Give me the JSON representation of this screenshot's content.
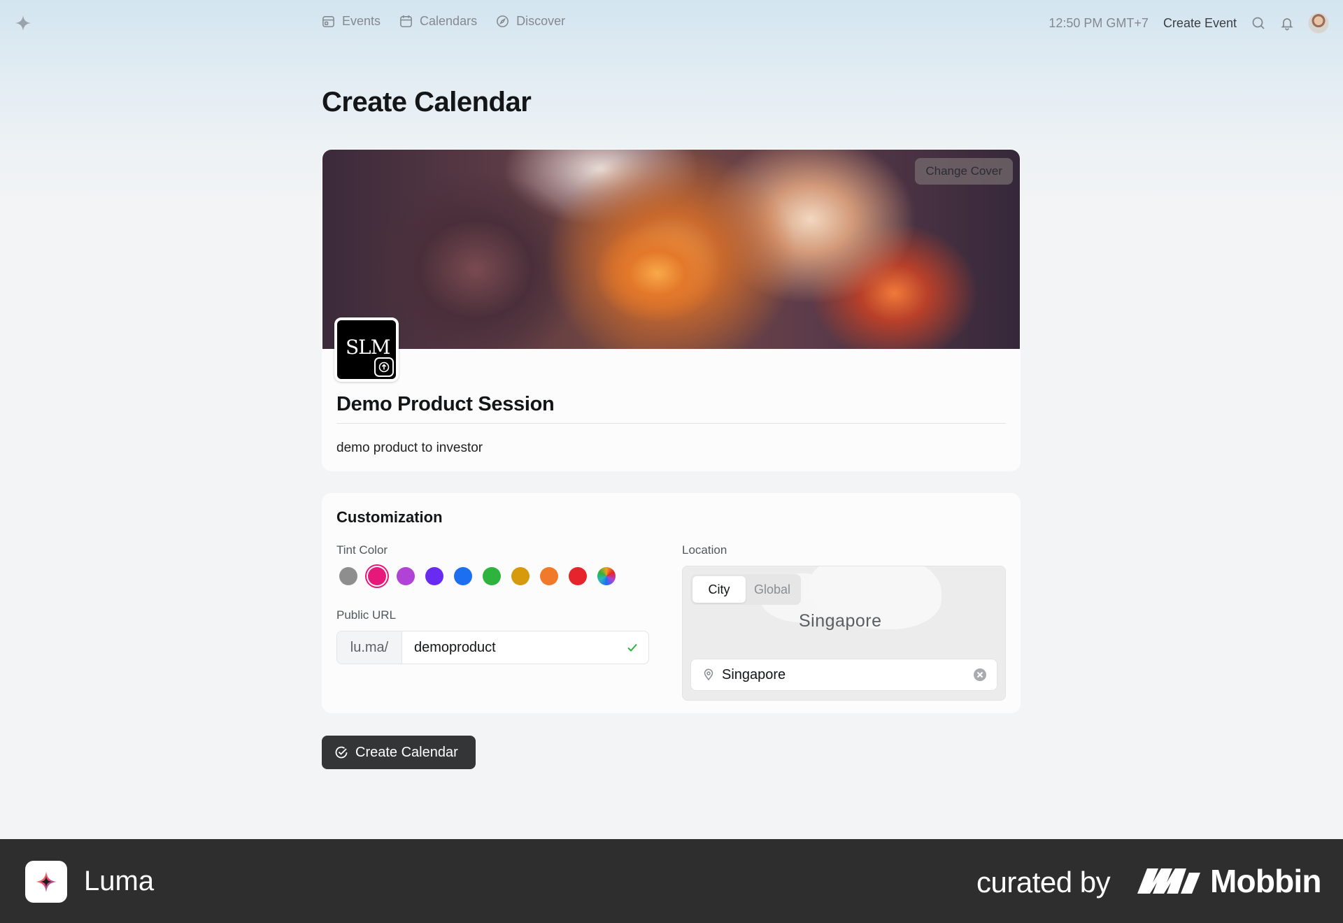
{
  "nav": {
    "links": [
      {
        "label": "Events",
        "icon": "calendar-event-icon"
      },
      {
        "label": "Calendars",
        "icon": "calendar-icon"
      },
      {
        "label": "Discover",
        "icon": "compass-icon"
      }
    ],
    "time": "12:50 PM GMT+7",
    "create_event": "Create Event"
  },
  "page": {
    "title": "Create Calendar"
  },
  "calendar": {
    "change_cover": "Change Cover",
    "avatar_text": "SLM",
    "name": "Demo Product Session",
    "description": "demo product to investor"
  },
  "customization": {
    "title": "Customization",
    "tint_label": "Tint Color",
    "tint_colors": [
      "#8e8e8e",
      "#e6197a",
      "#b142d6",
      "#6a2bf0",
      "#1d6ff2",
      "#2eb33d",
      "#d89a0d",
      "#f07a2a",
      "#e5252b",
      "rainbow"
    ],
    "selected_tint": "#e6197a",
    "url_label": "Public URL",
    "url_prefix": "lu.ma/",
    "url_value": "demoproduct",
    "location_label": "Location",
    "map_toggle": [
      "City",
      "Global"
    ],
    "map_toggle_active": "City",
    "map_label": "Singapore",
    "location_value": "Singapore"
  },
  "actions": {
    "create": "Create Calendar"
  },
  "footer": {
    "app_name": "Luma",
    "curated_by": "curated by",
    "brand": "Mobbin"
  }
}
